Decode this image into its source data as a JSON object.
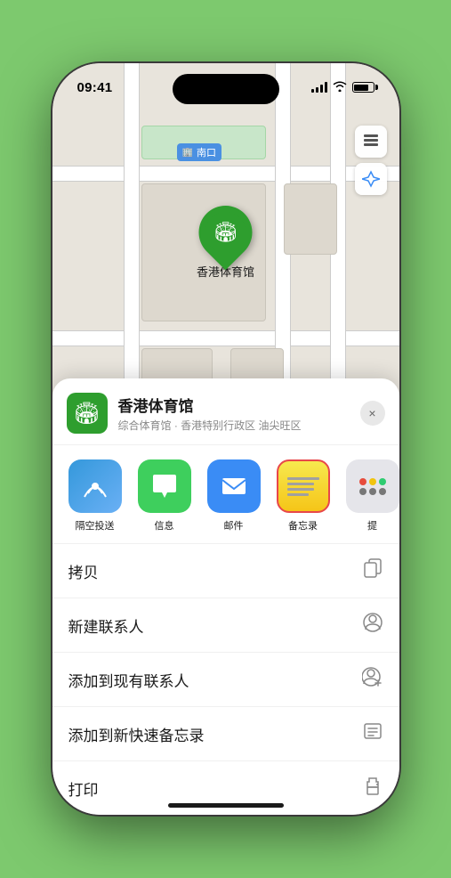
{
  "status_bar": {
    "time": "09:41",
    "location_arrow": "▶"
  },
  "map": {
    "label_text": "南口",
    "pin_label": "香港体育馆"
  },
  "sheet": {
    "venue_name": "香港体育馆",
    "venue_desc": "综合体育馆 · 香港特别行政区 油尖旺区",
    "close_label": "×"
  },
  "share_items": [
    {
      "label": "隔空投送",
      "type": "airdrop"
    },
    {
      "label": "信息",
      "type": "messages"
    },
    {
      "label": "邮件",
      "type": "mail"
    },
    {
      "label": "备忘录",
      "type": "notes"
    },
    {
      "label": "提",
      "type": "more"
    }
  ],
  "actions": [
    {
      "label": "拷贝",
      "icon": "copy"
    },
    {
      "label": "新建联系人",
      "icon": "contact"
    },
    {
      "label": "添加到现有联系人",
      "icon": "add-contact"
    },
    {
      "label": "添加到新快速备忘录",
      "icon": "memo"
    },
    {
      "label": "打印",
      "icon": "print"
    }
  ]
}
